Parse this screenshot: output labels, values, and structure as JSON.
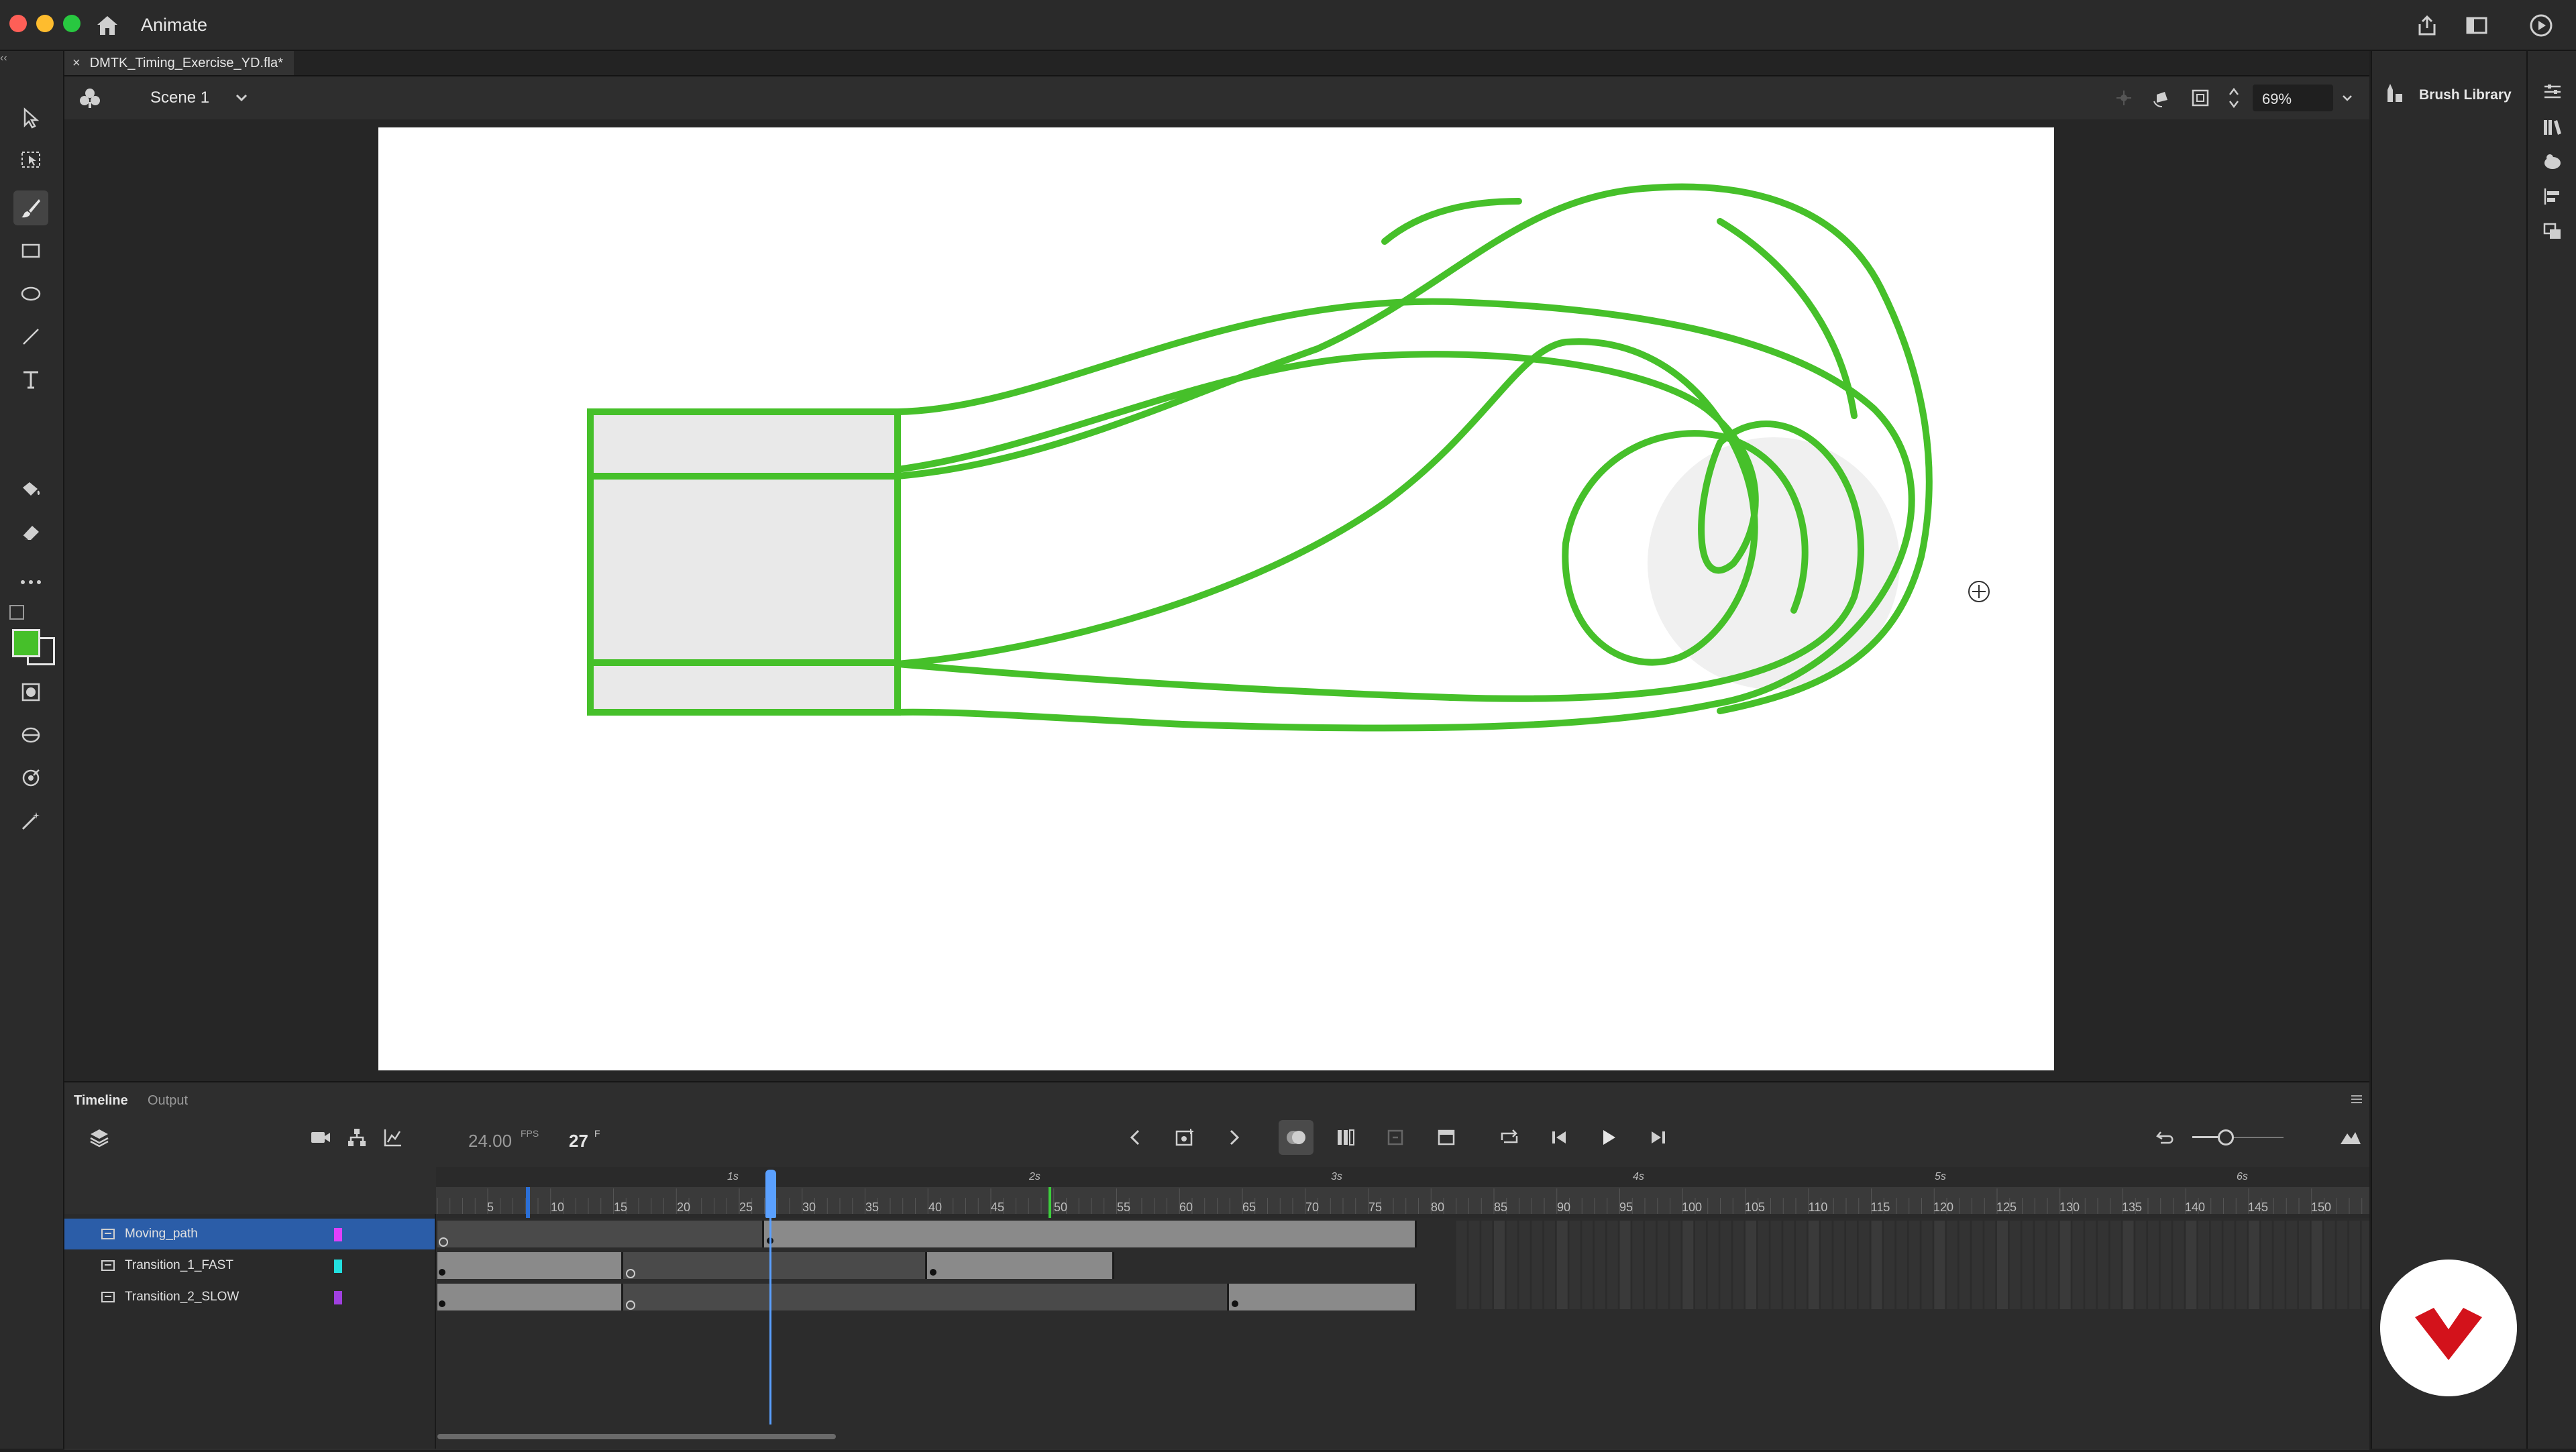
{
  "app": {
    "name": "Animate"
  },
  "document": {
    "tab_name": "DMTK_Timing_Exercise_YD.fla*"
  },
  "scene": {
    "name": "Scene 1"
  },
  "view": {
    "zoom": "69%"
  },
  "panels": {
    "brush_library_label": "Brush Library"
  },
  "timeline": {
    "tabs": [
      "Timeline",
      "Output"
    ],
    "fps_value": "24.00",
    "fps_unit": "FPS",
    "current_frame": "27",
    "frame_unit": "F",
    "ruler_numbers": [
      "5",
      "10",
      "15",
      "20",
      "25",
      "30",
      "35",
      "40",
      "45",
      "50",
      "55",
      "60",
      "65",
      "70",
      "75",
      "80",
      "85",
      "90",
      "95",
      "100",
      "105",
      "110",
      "115",
      "120",
      "125",
      "130",
      "135",
      "140",
      "145",
      "150"
    ],
    "second_markers": [
      "1s",
      "2s",
      "3s",
      "4s",
      "5s",
      "6s"
    ],
    "layers": [
      {
        "name": "Moving_path",
        "color": "#e040fb",
        "selected": true
      },
      {
        "name": "Transition_1_FAST",
        "color": "#22e0e0",
        "selected": false
      },
      {
        "name": "Transition_2_SLOW",
        "color": "#a040e0",
        "selected": false
      }
    ]
  },
  "colors": {
    "stroke_color": "#46c02a",
    "accent_blue": "#2b6fd6",
    "playhead": "#5aa0ff",
    "fill_color_swatch": "#46c02a"
  }
}
